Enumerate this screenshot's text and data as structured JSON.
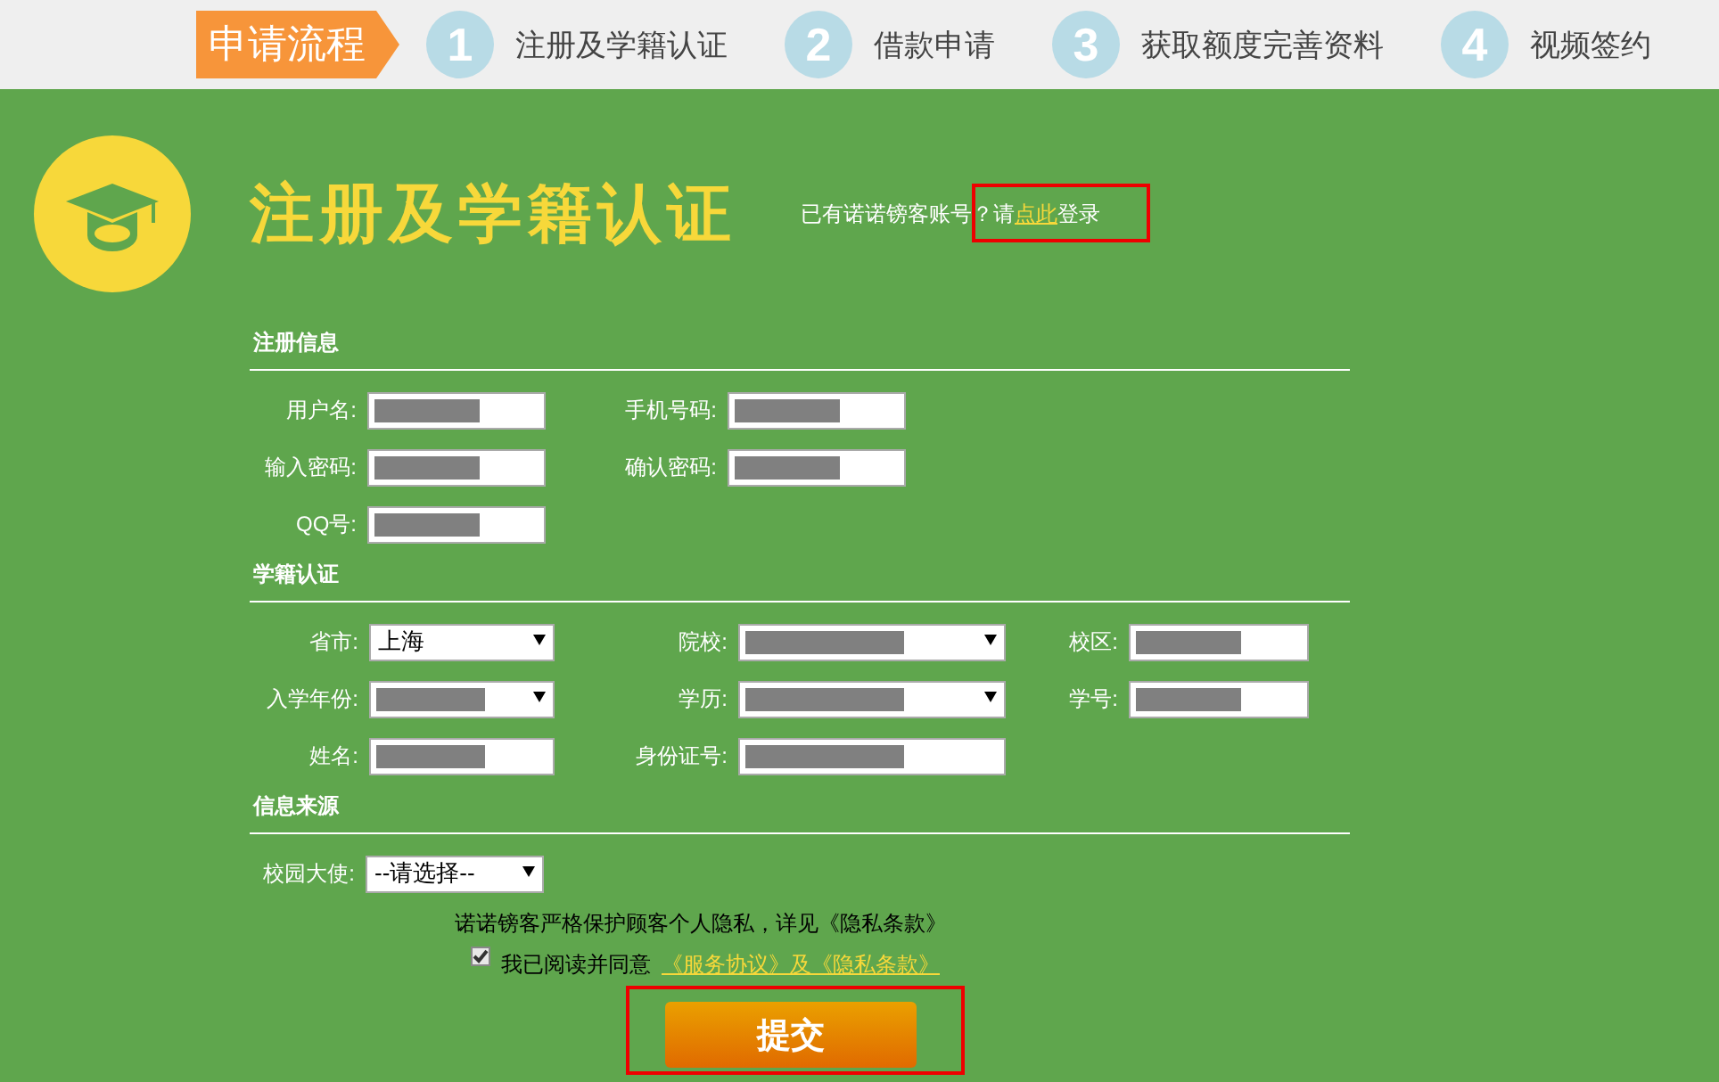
{
  "steps": {
    "title": "申请流程",
    "items": [
      {
        "number": "1",
        "label": "注册及学籍认证"
      },
      {
        "number": "2",
        "label": "借款申请"
      },
      {
        "number": "3",
        "label": "获取额度完善资料"
      },
      {
        "number": "4",
        "label": "视频签约"
      }
    ]
  },
  "header": {
    "title": "注册及学籍认证",
    "login_hint": {
      "before": "已有诺诺镑客账号？请",
      "link": "点此",
      "after": "登录",
      "highlighted": true
    }
  },
  "sections": [
    {
      "title": "注册信息",
      "rows": [
        [
          {
            "label": "用户名:",
            "kind": "text",
            "redacted": true
          },
          {
            "label": "手机号码:",
            "kind": "text",
            "redacted": true
          }
        ],
        [
          {
            "label": "输入密码:",
            "kind": "text",
            "redacted": true
          },
          {
            "label": "确认密码:",
            "kind": "text",
            "redacted": true
          }
        ],
        [
          {
            "label": "QQ号:",
            "kind": "text",
            "redacted": true
          }
        ]
      ]
    },
    {
      "title": "学籍认证",
      "rows": [
        [
          {
            "label": "省市:",
            "kind": "select",
            "value": "上海",
            "redacted": false
          },
          {
            "label": "院校:",
            "kind": "select",
            "redacted": true
          },
          {
            "label": "校区:",
            "kind": "text",
            "redacted": true
          }
        ],
        [
          {
            "label": "入学年份:",
            "kind": "select",
            "redacted": true
          },
          {
            "label": "学历:",
            "kind": "select",
            "redacted": true
          },
          {
            "label": "学号:",
            "kind": "text",
            "redacted": true
          }
        ],
        [
          {
            "label": "姓名:",
            "kind": "text",
            "redacted": true
          },
          {
            "label": "身份证号:",
            "kind": "text",
            "redacted": true
          }
        ]
      ]
    },
    {
      "title": "信息来源",
      "rows": [
        [
          {
            "label": "校园大使:",
            "kind": "select",
            "value": "--请选择--",
            "redacted": false
          }
        ]
      ]
    }
  ],
  "privacy_note": "诺诺镑客严格保护顾客个人隐私，详见《隐私条款》",
  "consent": {
    "checked": true,
    "label": "我已阅读并同意",
    "link": "《服务协议》及《隐私条款》"
  },
  "submit": {
    "label": "提交",
    "highlighted": true
  }
}
